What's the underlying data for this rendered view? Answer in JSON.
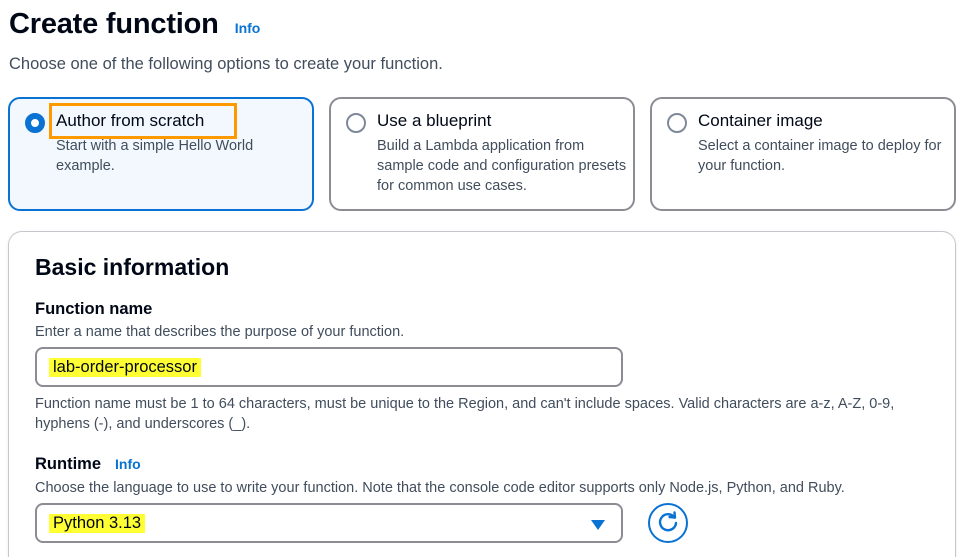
{
  "header": {
    "title": "Create function",
    "info_label": "Info",
    "subtitle": "Choose one of the following options to create your function."
  },
  "options": [
    {
      "label": "Author from scratch",
      "description": "Start with a simple Hello World example.",
      "selected": true
    },
    {
      "label": "Use a blueprint",
      "description": "Build a Lambda application from sample code and configuration presets for common use cases.",
      "selected": false
    },
    {
      "label": "Container image",
      "description": "Select a container image to deploy for your function.",
      "selected": false
    }
  ],
  "basic_info": {
    "title": "Basic information",
    "function_name": {
      "label": "Function name",
      "description": "Enter a name that describes the purpose of your function.",
      "value": "lab-order-processor",
      "constraint": "Function name must be 1 to 64 characters, must be unique to the Region, and can't include spaces. Valid characters are a-z, A-Z, 0-9, hyphens (-), and underscores (_)."
    },
    "runtime": {
      "label": "Runtime",
      "info_label": "Info",
      "description": "Choose the language to use to write your function. Note that the console code editor supports only Node.js, Python, and Ruby.",
      "selected_value": "Python 3.13"
    }
  },
  "colors": {
    "accent": "#0972d3",
    "highlight_orange": "#ff9900",
    "highlight_yellow": "#ffff33"
  },
  "icons": {
    "dropdown": "caret-down-icon",
    "refresh": "refresh-icon"
  }
}
